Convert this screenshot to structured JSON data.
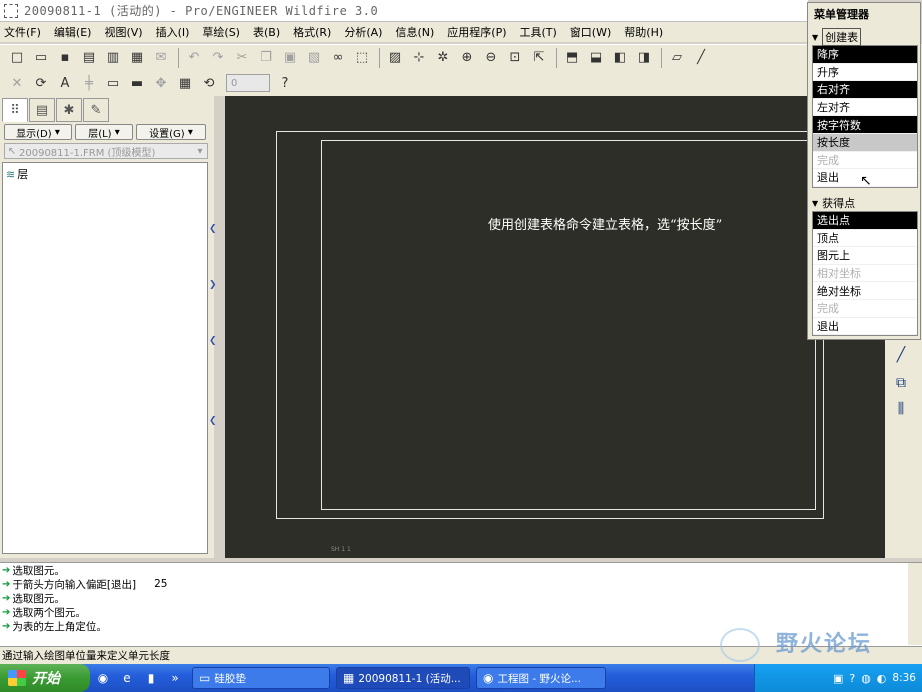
{
  "window": {
    "title": "20090811-1 (活动的) - Pro/ENGINEER Wildfire 3.0"
  },
  "menubar": [
    "文件(F)",
    "编辑(E)",
    "视图(V)",
    "插入(I)",
    "草绘(S)",
    "表(B)",
    "格式(R)",
    "分析(A)",
    "信息(N)",
    "应用程序(P)",
    "工具(T)",
    "窗口(W)",
    "帮助(H)"
  ],
  "toolbar": {
    "spin_value": "0"
  },
  "left_panel": {
    "dropdowns": {
      "show": "显示(D)",
      "layer": "层(L)",
      "settings": "设置(G)"
    },
    "model_select": "20090811-1.FRM (顶级模型)",
    "tree_item": "层"
  },
  "canvas": {
    "caption": "使用创建表格命令建立表格，选“按长度”",
    "corner_mark": "SH 1 1"
  },
  "menu_manager": {
    "title": "菜单管理器",
    "create_table": {
      "title": "创建表",
      "items": [
        {
          "label": "降序",
          "state": "sel"
        },
        {
          "label": "升序",
          "state": ""
        },
        {
          "label": "右对齐",
          "state": "sel"
        },
        {
          "label": "左对齐",
          "state": ""
        },
        {
          "label": "按字符数",
          "state": "sel"
        },
        {
          "label": "按长度",
          "state": "hover"
        },
        {
          "label": "完成",
          "state": "disabled"
        },
        {
          "label": "退出",
          "state": ""
        }
      ]
    },
    "get_point": {
      "title": "获得点",
      "items": [
        {
          "label": "选出点",
          "state": "sel"
        },
        {
          "label": "顶点",
          "state": ""
        },
        {
          "label": "图元上",
          "state": ""
        },
        {
          "label": "相对坐标",
          "state": "disabled"
        },
        {
          "label": "绝对坐标",
          "state": ""
        },
        {
          "label": "完成",
          "state": "disabled"
        },
        {
          "label": "退出",
          "state": ""
        }
      ]
    }
  },
  "messages": [
    {
      "text": "选取图元。",
      "value": ""
    },
    {
      "text": "于箭头方向输入偏距[退出]",
      "value": "25"
    },
    {
      "text": "选取图元。",
      "value": ""
    },
    {
      "text": "选取两个图元。",
      "value": ""
    },
    {
      "text": "为表的左上角定位。",
      "value": ""
    }
  ],
  "status_bar": "通过输入绘图单位量来定义单元长度",
  "watermark": "野火论坛",
  "taskbar": {
    "start": "开始",
    "buttons": [
      "硅胶垫",
      "20090811-1 (活动...",
      "工程图 - 野火论..."
    ],
    "clock": "8:36"
  }
}
